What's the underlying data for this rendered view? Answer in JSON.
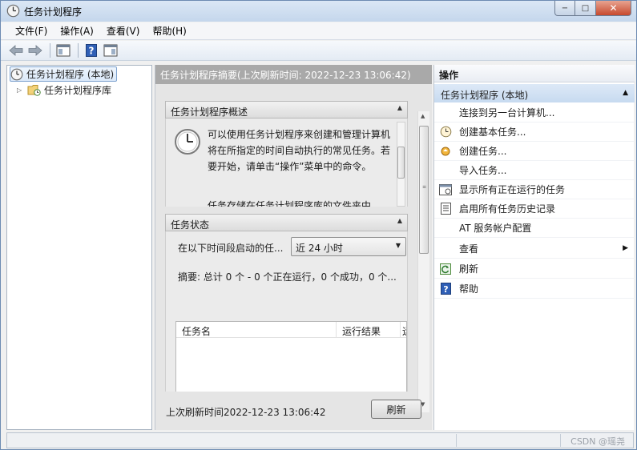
{
  "window": {
    "title": "任务计划程序",
    "min_label": "−",
    "max_label": "□",
    "close_label": "✕"
  },
  "menu": [
    "文件(F)",
    "操作(A)",
    "查看(V)",
    "帮助(H)"
  ],
  "tree": {
    "root": "任务计划程序 (本地)",
    "child": "任务计划程序库"
  },
  "center": {
    "header": "任务计划程序摘要(上次刷新时间: 2022-12-23 13:06:42)",
    "overview_title": "任务计划程序概述",
    "overview_text": "可以使用任务计划程序来创建和管理计算机将在所指定的时间自动执行的常见任务。若要开始，请单击“操作”菜单中的命令。",
    "overview_cut": "任务存储在任务计划程序库的文件夹中",
    "status_title": "任务状态",
    "status_label": "在以下时间段启动的任...",
    "status_select": "近 24 小时",
    "summary": "摘要: 总计 0 个 - 0 个正在运行，0 个成功，0 个...",
    "table_columns": [
      "任务名",
      "运行结果",
      "运"
    ],
    "last_refresh": "上次刷新时间2022-12-23 13:06:42",
    "refresh_button": "刷新"
  },
  "actions": {
    "title": "操作",
    "group": "任务计划程序 (本地)",
    "items": [
      {
        "label": "连接到另一台计算机...",
        "icon": "none"
      },
      {
        "label": "创建基本任务...",
        "icon": "clock-icon"
      },
      {
        "label": "创建任务...",
        "icon": "task-icon"
      },
      {
        "label": "导入任务...",
        "icon": "none"
      },
      {
        "label": "显示所有正在运行的任务",
        "icon": "running-tasks-icon"
      },
      {
        "label": "启用所有任务历史记录",
        "icon": "history-icon"
      },
      {
        "label": "AT 服务帐户配置",
        "icon": "none"
      },
      {
        "label": "查看",
        "icon": "none"
      },
      {
        "label": "刷新",
        "icon": "refresh-icon"
      },
      {
        "label": "帮助",
        "icon": "help-icon"
      }
    ]
  },
  "statusbar": {
    "watermark": "CSDN @瑶尧"
  }
}
